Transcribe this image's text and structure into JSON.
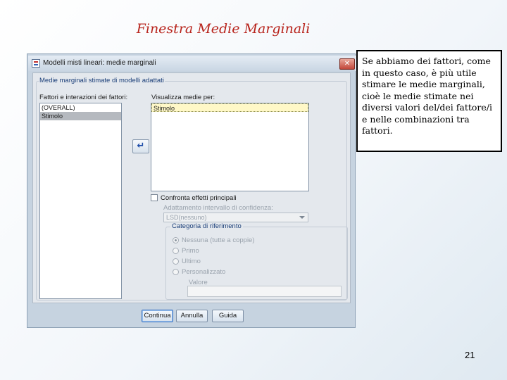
{
  "slide": {
    "title": "Finestra Medie Marginali",
    "page_number": "21",
    "note": "Se abbiamo dei fattori, come in questo caso, è più utile stimare le medie marginali, cioè le medie stimate nei diversi valori del/dei fattore/i e nelle combinazioni tra fattori."
  },
  "dialog": {
    "title": "Modelli misti lineari: medie marginali",
    "close_label": "✕",
    "group_title": "Medie marginali stimate di modelli adattati",
    "factors_label": "Fattori e interazioni dei fattori:",
    "factors_items": [
      "(OVERALL)",
      "Stimolo"
    ],
    "display_label": "Visualizza medie per:",
    "display_items": [
      "Stimolo"
    ],
    "move_icon": "↵",
    "compare_label": "Confronta effetti principali",
    "ci_label": "Adattamento intervallo di confidenza:",
    "ci_value": "LSD(nessuno)",
    "ref_title": "Categoria di riferimento",
    "radios": [
      {
        "label": "Nessuna (tutte a coppie)",
        "selected": true
      },
      {
        "label": "Primo",
        "selected": false
      },
      {
        "label": "Ultimo",
        "selected": false
      },
      {
        "label": "Personalizzato",
        "selected": false
      }
    ],
    "value_label": "Valore",
    "buttons": {
      "continue": "Continua",
      "cancel": "Annulla",
      "help": "Guida"
    }
  }
}
